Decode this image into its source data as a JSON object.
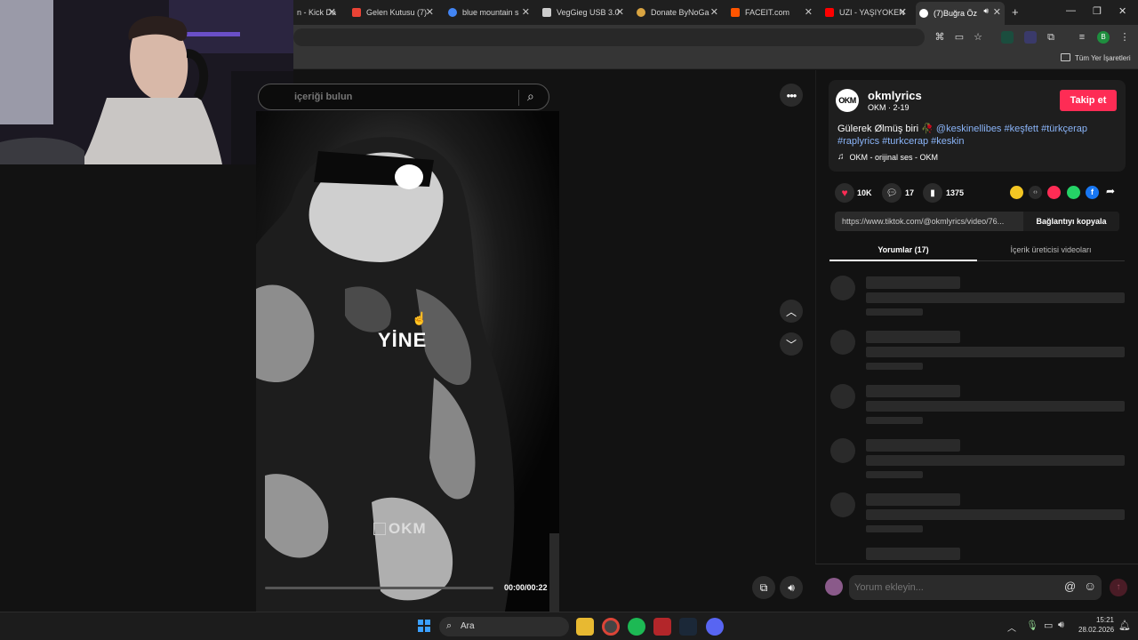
{
  "browser": {
    "tabs": [
      {
        "label": "n - Kick Da",
        "favicon_color": "#53fc18"
      },
      {
        "label": "Gelen Kutusu (7)",
        "favicon_color": "#ea4335"
      },
      {
        "label": "blue mountain s",
        "favicon_color": "#4285f4"
      },
      {
        "label": "VegGieg USB 3.0",
        "favicon_color": "#cccccc"
      },
      {
        "label": "Donate ByNoGa",
        "favicon_color": "#d9a441"
      },
      {
        "label": "FACEIT.com",
        "favicon_color": "#ff5500"
      },
      {
        "label": "UZI - YAŞIYOKEN",
        "favicon_color": "#ff0000"
      },
      {
        "label": "(7)Buğra Öz",
        "favicon_color": "#ffffff"
      }
    ],
    "new_tab_label": "+",
    "profile_initial": "B",
    "bookmarks_label": "Tüm Yer İşaretleri"
  },
  "video": {
    "search_placeholder": "içeriği bulun",
    "overlay_text": "YİNE",
    "watermark_text": "OKM",
    "time": "00:00/00:22",
    "progress": 0.0
  },
  "profile": {
    "avatar_text": "OKM",
    "username": "okmlyrics",
    "subtitle": "OKM · 2-19",
    "follow_label": "Takip et",
    "caption_plain": "Gülerek Ølmüş biri 🥀",
    "caption_tags_1": "@keskinellibes #keşfett #türkçerap",
    "caption_tags_2": "#raplyrics #turkcerap #keskin",
    "music_label": "OKM - orijinal ses - OKM"
  },
  "stats": {
    "likes": "10K",
    "comments": "17",
    "saves": "1375"
  },
  "link": {
    "url": "https://www.tiktok.com/@okmlyrics/video/76...",
    "copy_label": "Bağlantıyı kopyala"
  },
  "tabs": {
    "comments": "Yorumlar (17)",
    "creator_videos": "İçerik üreticisi videoları"
  },
  "comment_input": {
    "placeholder": "Yorum ekleyin..."
  },
  "taskbar": {
    "search_label": "Ara",
    "time": "15:21",
    "date": "28.02.2026"
  },
  "colors": {
    "accent": "#fe2c55",
    "link": "#8ab4f8"
  }
}
